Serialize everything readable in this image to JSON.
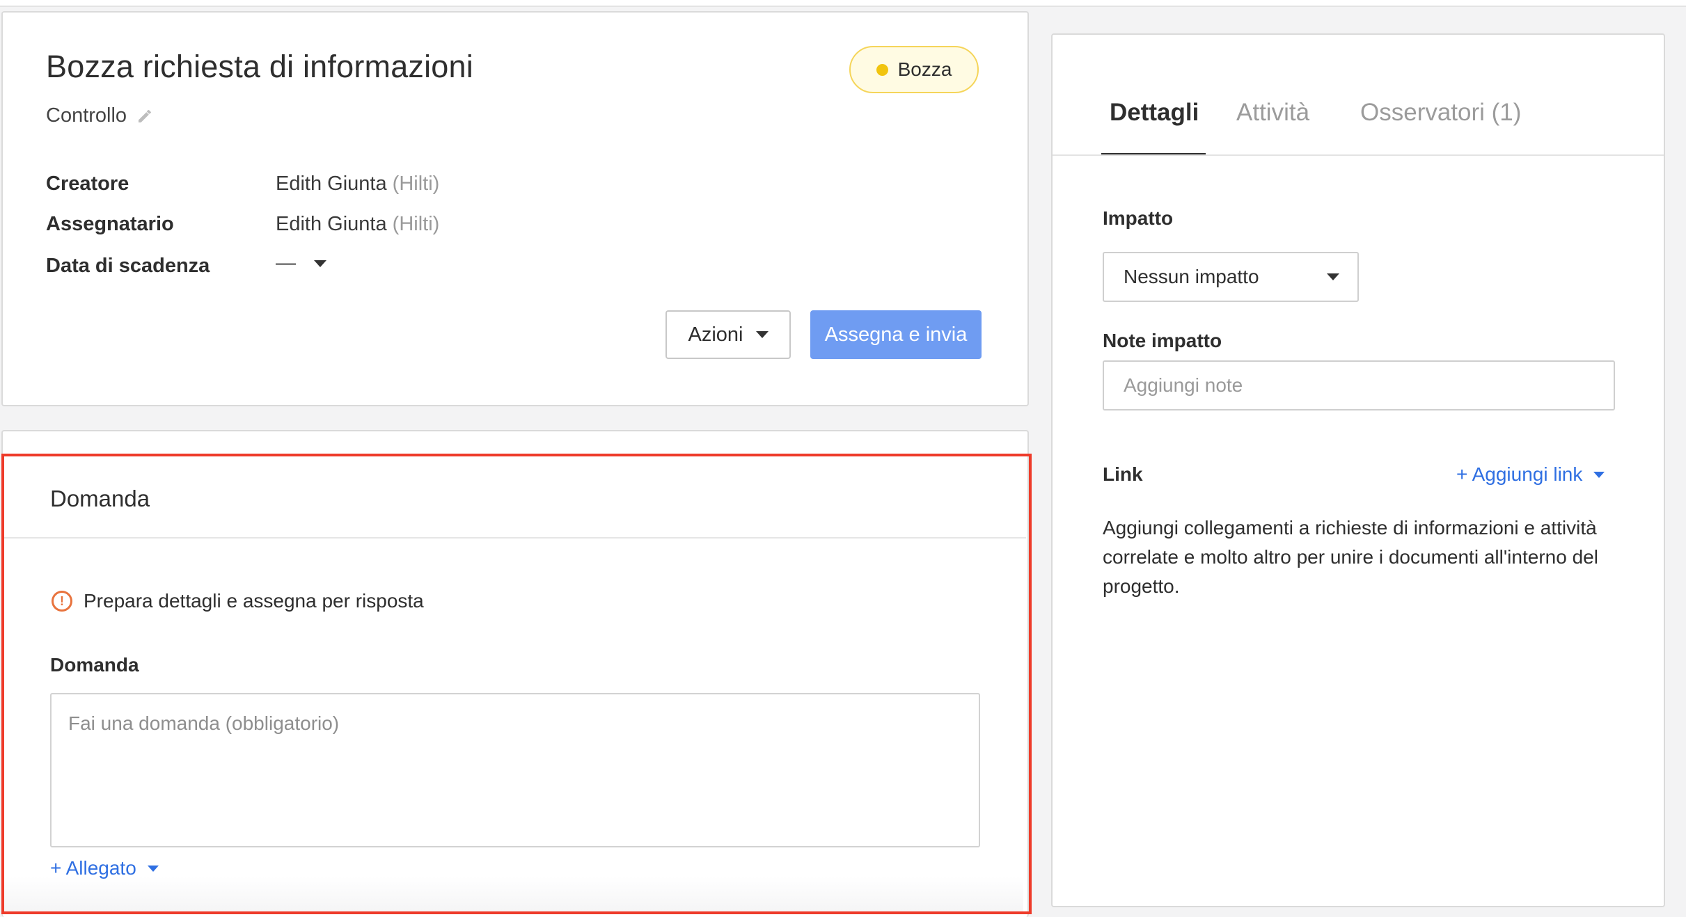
{
  "header": {
    "title": "Bozza richiesta di informazioni",
    "subtitle": "Controllo",
    "status": "Bozza",
    "meta": {
      "creator_label": "Creatore",
      "creator_name": "Edith Giunta",
      "creator_org": "(Hilti)",
      "assignee_label": "Assegnatario",
      "assignee_name": "Edith Giunta",
      "assignee_org": "(Hilti)",
      "due_label": "Data di scadenza",
      "due_value": "—"
    },
    "actions_label": "Azioni",
    "assign_label": "Assegna e invia"
  },
  "domanda": {
    "section_title": "Domanda",
    "info_text": "Prepara dettagli e assegna per risposta",
    "field_label": "Domanda",
    "placeholder": "Fai una domanda (obbligatorio)",
    "attachment_label": "+ Allegato"
  },
  "side": {
    "tabs": [
      {
        "label": "Dettagli",
        "active": true
      },
      {
        "label": "Attività",
        "active": false
      },
      {
        "label": "Osservatori (1)",
        "active": false
      }
    ],
    "impact_label": "Impatto",
    "impact_value": "Nessun impatto",
    "notes_label": "Note impatto",
    "notes_placeholder": "Aggiungi note",
    "link_label": "Link",
    "add_link_label": "+ Aggiungi link",
    "link_description": "Aggiungi collegamenti a richieste di informazioni e attività correlate e molto altro per unire i documenti all'interno del progetto."
  },
  "colors": {
    "accent_blue": "#6f9cf2",
    "link_blue": "#2f6fe2",
    "status_yellow": "#f1c40f",
    "warning_orange": "#e8733d",
    "highlight_red": "#ee3b2a"
  },
  "icons": [
    "pencil-icon",
    "caret-down-icon",
    "warning-icon"
  ]
}
